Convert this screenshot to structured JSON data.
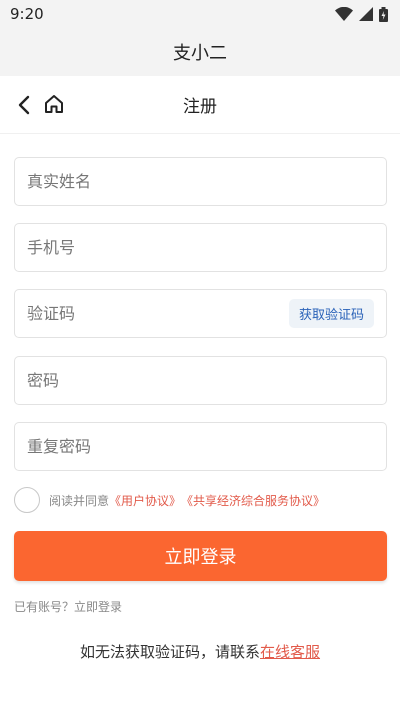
{
  "status_bar": {
    "time": "9:20",
    "icons": [
      "wifi-icon",
      "signal-icon",
      "battery-icon"
    ]
  },
  "app_header": {
    "title": "支小二"
  },
  "nav": {
    "title": "注册",
    "icons": [
      "back-icon",
      "home-icon"
    ]
  },
  "form": {
    "name_placeholder": "真实姓名",
    "phone_placeholder": "手机号",
    "code_placeholder": "验证码",
    "code_button": "获取验证码",
    "password_placeholder": "密码",
    "confirm_password_placeholder": "重复密码"
  },
  "agreement": {
    "prefix": "阅读并同意",
    "user_agreement": "《用户协议》",
    "service_agreement": "《共享经济综合服务协议》",
    "checked": false
  },
  "submit_label": "立即登录",
  "login_link": "已有账号？立即登录",
  "help": {
    "text": "如无法获取验证码，请联系",
    "link": "在线客服"
  },
  "colors": {
    "accent": "#fb6630",
    "link": "#e25a4a",
    "code_button_text": "#2a62b8",
    "header_bg": "#f3f3f3"
  }
}
